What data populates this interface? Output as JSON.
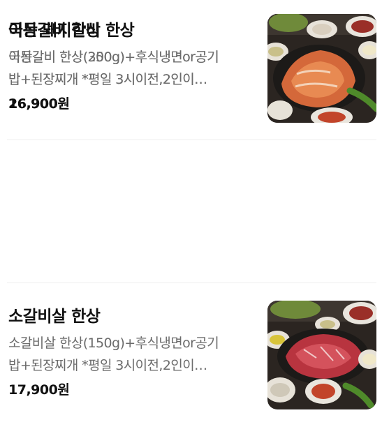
{
  "menu": {
    "items": [
      {
        "name": "이동갈비 한상",
        "desc_line1": "이동갈비 한상(300g)+후식냉면or공기",
        "desc_line2": "밥+된장찌개 *평일 3시이전,2인이…",
        "price": "26,900원",
        "photo": "pork-galbi-set-photo",
        "meat_color": "#b5522a"
      },
      {
        "name": "소갈비살 한상",
        "desc_line1": "소갈비살 한상(150g)+후식냉면or공기",
        "desc_line2": "밥+된장찌개 *평일 3시이전,2인이…",
        "price": "17,900원",
        "photo": "beef-rib-set-photo",
        "meat_color": "#b8343f"
      },
      {
        "name": "국산 돼지갈비 한상",
        "desc_line1": "국산갈비 한상(250g)+후식냉면or공기",
        "desc_line2": "밥+된장찌개 *평일 3시이전,2인이…",
        "price": "16,900원",
        "photo": "pork-rib-set-photo",
        "meat_color": "#d4683a"
      }
    ]
  }
}
